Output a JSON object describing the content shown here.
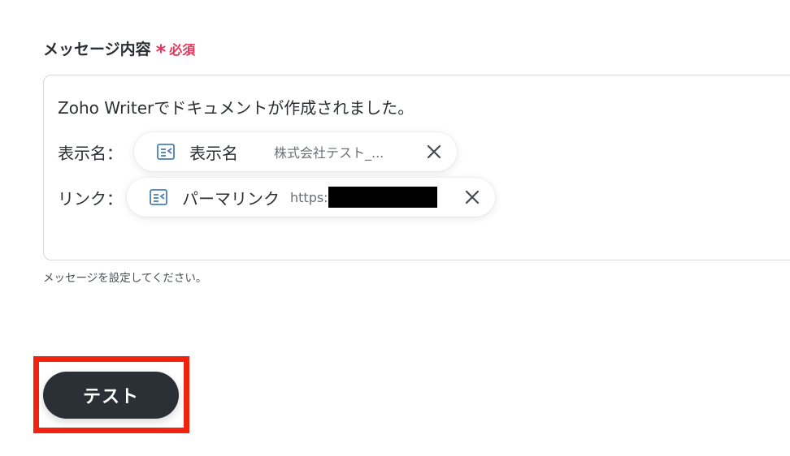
{
  "field": {
    "label": "メッセージ内容",
    "required_star": "*",
    "required_text": "必須"
  },
  "message": {
    "line1": "Zoho Writerでドキュメントが作成されました。",
    "line2_label": "表示名：",
    "line3_label": "リンク："
  },
  "pills": [
    {
      "label": "表示名",
      "value": "株式会社テスト_...",
      "icon": "document-icon",
      "close_icon": "close-icon"
    },
    {
      "label": "パーマリンク",
      "value": "https:",
      "icon": "document-icon",
      "close_icon": "close-icon"
    }
  ],
  "helper_text": "メッセージを設定してください。",
  "test_button_label": "テスト",
  "colors": {
    "required": "#e8325a",
    "button_bg": "#2b2f36",
    "highlight": "#f2230e",
    "icon": "#4a7fb5"
  }
}
